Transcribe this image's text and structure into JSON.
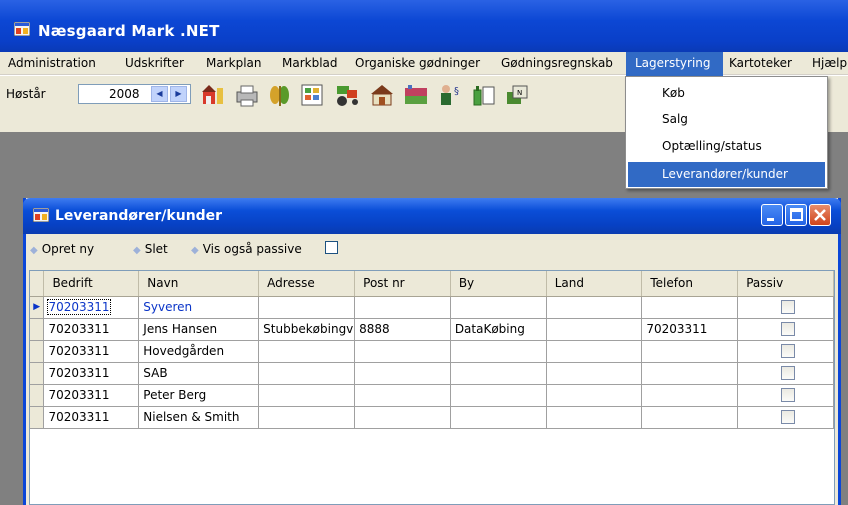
{
  "app": {
    "title": "Næsgaard Mark .NET"
  },
  "menu": {
    "items": [
      "Administration",
      "Udskrifter",
      "Markplan",
      "Markblad",
      "Organiske gødninger",
      "Gødningsregnskab",
      "Lagerstyring",
      "Kartoteker",
      "Hjælp"
    ],
    "active": "Lagerstyring"
  },
  "toolbar": {
    "year_label": "Høstår",
    "year_value": "2008"
  },
  "dropdown": {
    "items": [
      "Køb",
      "Salg",
      "Optælling/status",
      "Leverandører/kunder"
    ],
    "selected": "Leverandører/kunder"
  },
  "child": {
    "title": "Leverandører/kunder",
    "actions": {
      "new_label": "Opret ny",
      "delete_label": "Slet",
      "show_passive_label": "Vis også passive"
    }
  },
  "grid": {
    "columns": [
      "Bedrift",
      "Navn",
      "Adresse",
      "Post nr",
      "By",
      "Land",
      "Telefon",
      "Passiv"
    ],
    "rows": [
      [
        "70203311",
        "Syveren",
        "",
        "",
        "",
        "",
        "",
        ""
      ],
      [
        "70203311",
        "Jens Hansen",
        "Stubbekøbingv",
        "8888",
        "DataKøbing",
        "",
        "70203311",
        ""
      ],
      [
        "70203311",
        "Hovedgården",
        "",
        "",
        "",
        "",
        "",
        ""
      ],
      [
        "70203311",
        "SAB",
        "",
        "",
        "",
        "",
        "",
        ""
      ],
      [
        "70203311",
        "Peter Berg",
        "",
        "",
        "",
        "",
        "",
        ""
      ],
      [
        "70203311",
        "Nielsen & Smith",
        "",
        "",
        "",
        "",
        "",
        ""
      ]
    ]
  },
  "colors": {
    "titlebar": "#0a46d8",
    "selection": "#316ac5",
    "workspace": "#808080"
  }
}
